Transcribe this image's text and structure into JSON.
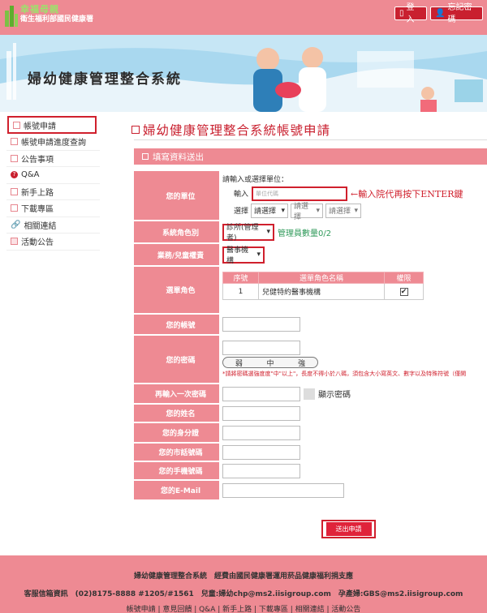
{
  "header": {
    "logo_line1": "幸福母親",
    "logo_line2": "衛生福利部國民健康署",
    "login_label": "登入",
    "forgot_label": "忘記密碼"
  },
  "banner": {
    "title": "婦幼健康管理整合系統"
  },
  "sidebar": {
    "items": [
      {
        "label": "帳號申請"
      },
      {
        "label": "帳號申請進度查詢"
      },
      {
        "label": "公告事項"
      },
      {
        "label": "Q&A"
      },
      {
        "label": "新手上路"
      },
      {
        "label": "下載專區"
      },
      {
        "label": "相關連結"
      },
      {
        "label": "活動公告"
      }
    ]
  },
  "main": {
    "title": "婦幼健康管理整合系統帳號申請",
    "section": "填寫資料送出"
  },
  "form": {
    "unit": {
      "label": "您的單位",
      "prompt": "請輸入或選擇單位：",
      "input_label": "輸入",
      "input_placeholder": "單位代碼",
      "hint": "←輸入院代再按下ENTER鍵",
      "select_label": "選擇",
      "select1": "請選擇",
      "select2": "請選擇",
      "select3": "請選擇"
    },
    "system_role": {
      "label": "系統角色別",
      "value": "診所(管理者)",
      "quota": "管理員數量0/2"
    },
    "business": {
      "label": "業務/兒童權責",
      "value": "醫事機構"
    },
    "choose_role": {
      "label": "選單角色",
      "headers": [
        "序號",
        "選單角色名稱",
        "權限"
      ],
      "rows": [
        {
          "no": "1",
          "name": "兒健特約醫事機構",
          "checked": "✔"
        }
      ]
    },
    "account": {
      "label": "您的帳號"
    },
    "password": {
      "label": "您的密碼",
      "strength": [
        "弱",
        "中",
        "強"
      ],
      "warning": "*請將密碼選強度度\"中\"以上\"，長度不得小於八碼，須包含大小寫英文、數字以及特殊符號（僅開"
    },
    "password2": {
      "label": "再輸入一次密碼",
      "show_label": "顯示密碼"
    },
    "name": {
      "label": "您的姓名"
    },
    "id": {
      "label": "您的身分證"
    },
    "tel": {
      "label": "您的市話號碼"
    },
    "mobile": {
      "label": "您的手機號碼"
    },
    "email": {
      "label": "您的E-Mail"
    },
    "submit": "送出申請"
  },
  "footer": {
    "line1": "婦幼健康管理整合系統　經費由國民健康署運用菸品健康福利捐支應",
    "line2": "客服信箱資訊　(02)8175-8888 #1205/#1561　兒童:婦幼chp@ms2.iisigroup.com　孕產婦:GBS@ms2.iisigroup.com",
    "line3": "帳號申請 | 意見回饋 | Q&A | 新手上路 | 下載專區 | 相關連結 | 活動公告"
  }
}
